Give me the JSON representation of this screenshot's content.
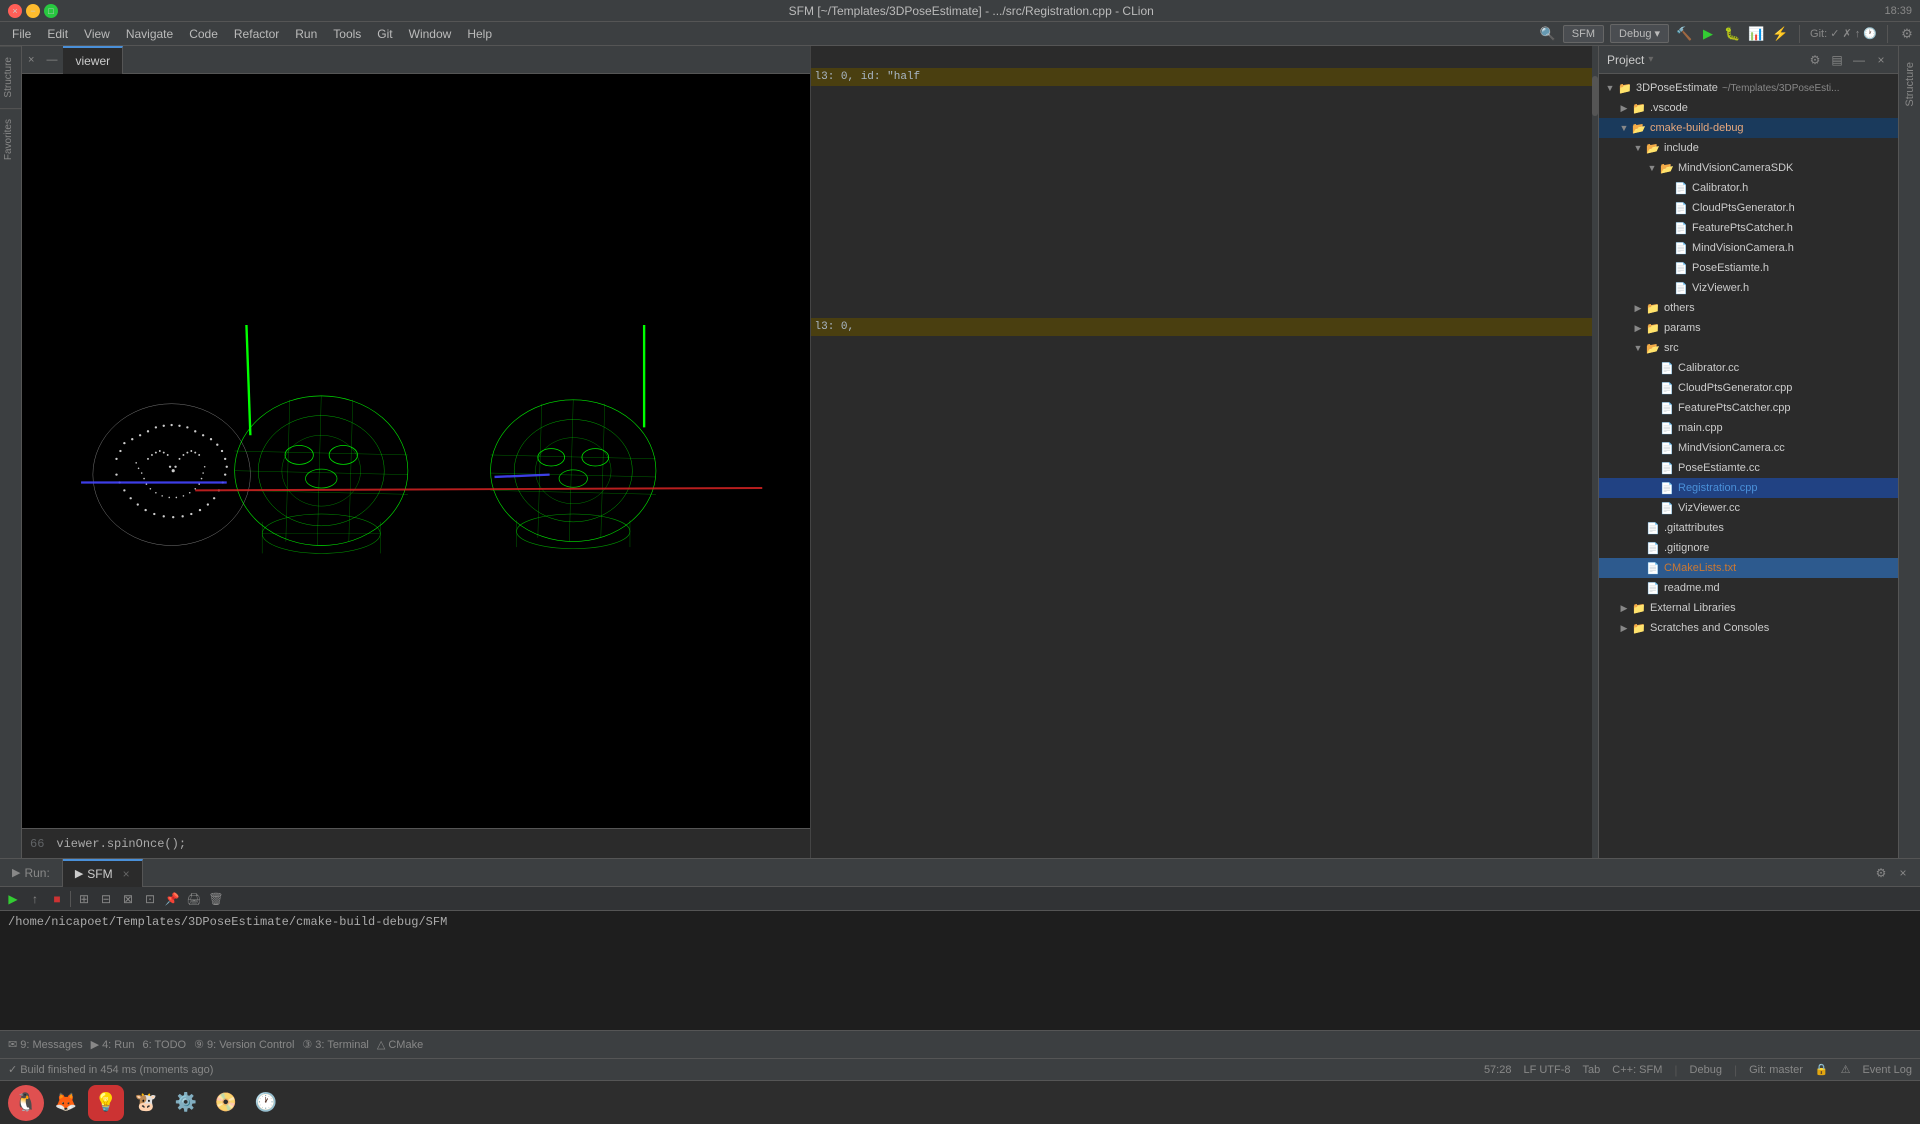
{
  "window": {
    "title": "SFM [~/Templates/3DPoseEstimate] - .../src/Registration.cpp - CLion",
    "time": "18:39"
  },
  "titlebar": {
    "close": "×",
    "min": "−",
    "max": "□"
  },
  "viewer": {
    "tab_label": "viewer"
  },
  "code_snippet": {
    "line_num": "66",
    "text": "viewer.spinOnce();"
  },
  "run_panel": {
    "label": "Run:",
    "tab_name": "SFM",
    "path": "/home/nicapoet/Templates/3DPoseEstimate/cmake-build-debug/SFM"
  },
  "project_tree": {
    "title": "Project",
    "root": {
      "name": "3DPoseEstimate",
      "meta": "~/Templates/3DPoseEsti...",
      "children": [
        {
          "name": ".vscode",
          "type": "folder",
          "expanded": false
        },
        {
          "name": "cmake-build-debug",
          "type": "folder",
          "expanded": true,
          "highlighted": true,
          "children": [
            {
              "name": "include",
              "type": "folder",
              "expanded": true,
              "children": [
                {
                  "name": "MindVisionCameraSDK",
                  "type": "folder",
                  "expanded": false,
                  "children": [
                    {
                      "name": "Calibrator.h",
                      "type": "h"
                    },
                    {
                      "name": "CloudPtsGenerator.h",
                      "type": "h"
                    },
                    {
                      "name": "FeaturePtsCatcher.h",
                      "type": "h"
                    },
                    {
                      "name": "MindVisionCamera.h",
                      "type": "h"
                    },
                    {
                      "name": "PoseEstiamte.h",
                      "type": "h"
                    },
                    {
                      "name": "VizViewer.h",
                      "type": "h"
                    }
                  ]
                }
              ]
            },
            {
              "name": "others",
              "type": "folder",
              "expanded": false
            },
            {
              "name": "params",
              "type": "folder",
              "expanded": false
            },
            {
              "name": "src",
              "type": "folder",
              "expanded": true,
              "children": [
                {
                  "name": "Calibrator.cc",
                  "type": "cpp"
                },
                {
                  "name": "CloudPtsGenerator.cpp",
                  "type": "cpp"
                },
                {
                  "name": "FeaturePtsCatcher.cpp",
                  "type": "cpp"
                },
                {
                  "name": "main.cpp",
                  "type": "cpp"
                },
                {
                  "name": "MindVisionCamera.cc",
                  "type": "cpp"
                },
                {
                  "name": "PoseEstiamte.cc",
                  "type": "cpp"
                },
                {
                  "name": "Registration.cpp",
                  "type": "cpp",
                  "active": true
                },
                {
                  "name": "VizViewer.cc",
                  "type": "cpp"
                }
              ]
            },
            {
              "name": ".gitattributes",
              "type": "git"
            },
            {
              "name": ".gitignore",
              "type": "git"
            },
            {
              "name": "CMakeLists.txt",
              "type": "cmake",
              "selected": true
            },
            {
              "name": "readme.md",
              "type": "md"
            }
          ]
        },
        {
          "name": "External Libraries",
          "type": "folder",
          "expanded": false
        },
        {
          "name": "Scratches and Consoles",
          "type": "folder",
          "expanded": false
        }
      ]
    }
  },
  "status_bar": {
    "messages": "9: Messages",
    "run": "4: Run",
    "todo": "6: TODO",
    "version_control": "9: Version Control",
    "terminal": "3: Terminal",
    "cmake": "CMake",
    "position": "57:28",
    "encoding": "LF  UTF-8",
    "tab_info": "Tab",
    "lang": "C++: SFM",
    "build_config": "Debug",
    "git": "Git: master",
    "event_log": "Event Log",
    "build_status": "Build finished in 454 ms (moments ago)"
  },
  "code_right": {
    "lines": [
      {
        "num": "",
        "text": ""
      },
      {
        "num": "",
        "text": "l3: 0, id: \"half"
      },
      {
        "num": "",
        "text": ""
      },
      {
        "num": "",
        "text": ""
      },
      {
        "num": "",
        "text": ""
      },
      {
        "num": "",
        "text": ""
      },
      {
        "num": "",
        "text": ""
      },
      {
        "num": "",
        "text": "l3: 0,"
      },
      {
        "num": "",
        "text": ""
      }
    ]
  },
  "taskbar": {
    "icons": [
      "🐧",
      "🦊",
      "💡",
      "🐮",
      "⚙️",
      "📀",
      "🕐"
    ]
  },
  "sidebar_left_tabs": [
    "Structure",
    "Favorites"
  ],
  "sidebar_right_tabs": [
    "Structure"
  ]
}
